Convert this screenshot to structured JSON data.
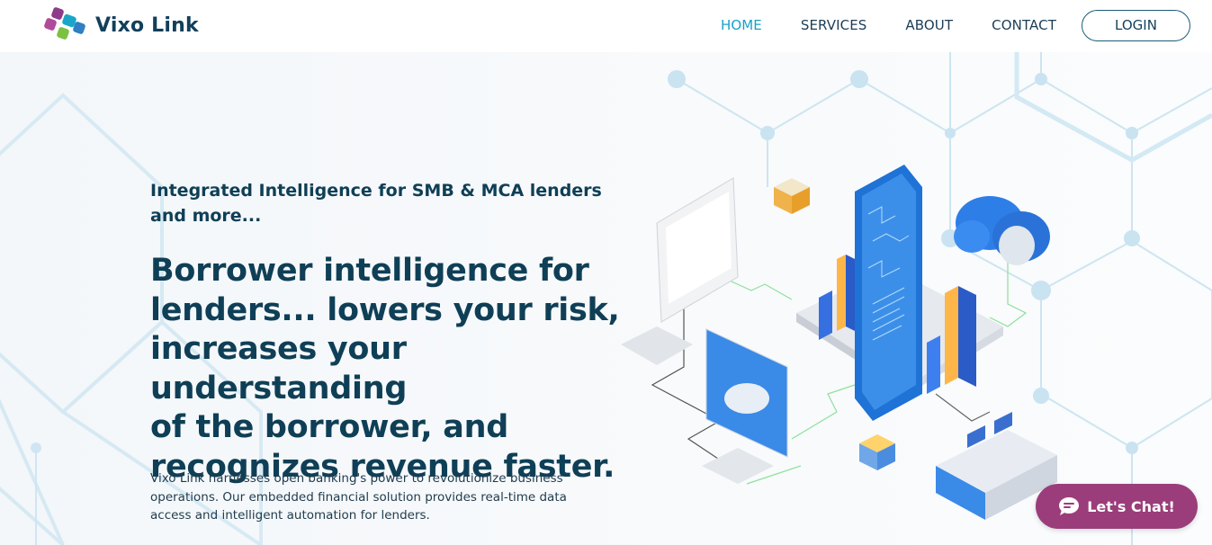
{
  "brand": {
    "name": "Vixo Link"
  },
  "nav": {
    "items": [
      {
        "label": "HOME",
        "active": true
      },
      {
        "label": "SERVICES",
        "active": false
      },
      {
        "label": "ABOUT",
        "active": false
      },
      {
        "label": "CONTACT",
        "active": false
      }
    ],
    "login_label": "LOGIN"
  },
  "hero": {
    "tagline": "Integrated Intelligence for SMB & MCA lenders and more...",
    "headline_lines": [
      "Borrower intelligence for",
      "lenders... lowers your risk,",
      "increases your understanding",
      "of the borrower, and",
      "recognizes revenue faster."
    ],
    "description": "Vixo Link harnesses open banking's power to revolutionize business operations. Our embedded financial solution provides real-time data access and intelligent automation for lenders."
  },
  "chat": {
    "label": "Let's Chat!",
    "icon": "chat-bubble-icon"
  },
  "colors": {
    "primary_text": "#0f3f56",
    "nav_active": "#1aa0c9",
    "chat_button": "#9b3d7b",
    "logo_purple": "#8e3b8a",
    "logo_teal": "#1aa6c9",
    "logo_green": "#7cc142"
  }
}
